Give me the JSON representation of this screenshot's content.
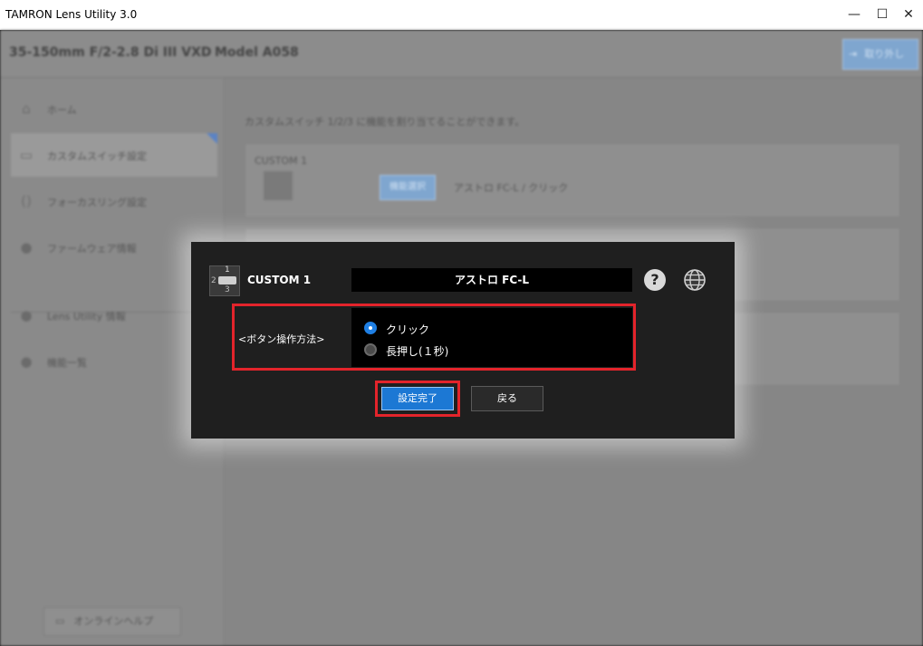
{
  "window": {
    "title": "TAMRON Lens Utility  3.0",
    "controls": {
      "minimize": "—",
      "maximize": "☐",
      "close": "✕"
    }
  },
  "header": {
    "lens_name": "35-150mm F/2-2.8 Di III VXD",
    "model": "Model A058",
    "remove_label": "取り外し"
  },
  "sidebar": {
    "items": [
      {
        "label": "ホーム",
        "icon": "home-icon"
      },
      {
        "label": "カスタムスイッチ設定",
        "icon": "switch-icon"
      },
      {
        "label": "フォーカスリング設定",
        "icon": "focus-ring-icon"
      },
      {
        "label": "ファームウェア情報",
        "icon": "firmware-icon"
      },
      {
        "label": "Lens Utility 情報",
        "icon": "info-icon"
      },
      {
        "label": "機能一覧",
        "icon": "list-icon"
      }
    ],
    "help_label": "オンラインヘルプ"
  },
  "main": {
    "description": "カスタムスイッチ 1/2/3 に機能を割り当てることができます。",
    "custom1": {
      "title": "CUSTOM 1",
      "button": "機能選択",
      "value": "アストロ FC-L  / クリック"
    }
  },
  "dialog": {
    "title": "CUSTOM 1",
    "icon_numbers": [
      "1",
      "2",
      "3"
    ],
    "function_name": "アストロ FC-L",
    "help_glyph": "?",
    "option_label": "<ボタン操作方法>",
    "options": [
      {
        "label": "クリック",
        "selected": true
      },
      {
        "label": "長押し(１秒)",
        "selected": false
      }
    ],
    "done_label": "設定完了",
    "back_label": "戻る"
  }
}
